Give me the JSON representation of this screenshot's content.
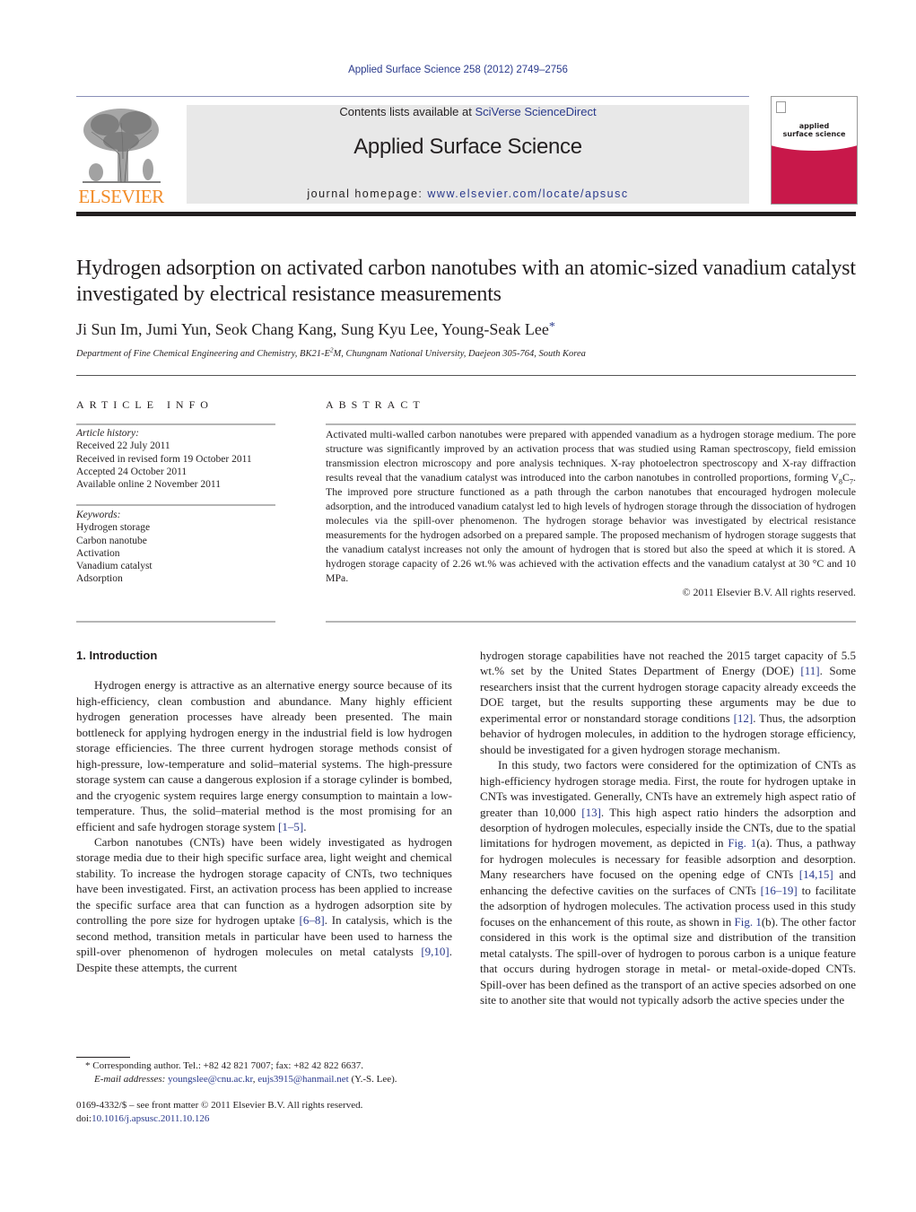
{
  "header": {
    "citation": "Applied Surface Science 258 (2012) 2749–2756",
    "publisher_logo_text": "ELSEVIER",
    "contents_prefix": "Contents lists available at ",
    "contents_link": "SciVerse ScienceDirect",
    "journal_name": "Applied Surface Science",
    "homepage_prefix": "journal homepage: ",
    "homepage_link": "www.elsevier.com/locate/apsusc",
    "cover_title_line1": "applied",
    "cover_title_line2": "surface science"
  },
  "article": {
    "title": "Hydrogen adsorption on activated carbon nanotubes with an atomic-sized vanadium catalyst investigated by electrical resistance measurements",
    "authors": "Ji Sun Im, Jumi Yun, Seok Chang Kang, Sung Kyu Lee, Young-Seak Lee",
    "corresponding_mark": "*",
    "affiliation_pre": "Department of Fine Chemical Engineering and Chemistry, BK21-E",
    "affiliation_sup": "2",
    "affiliation_post": "M, Chungnam National University, Daejeon 305-764, South Korea"
  },
  "article_info": {
    "heading": "ARTICLE INFO",
    "history_label": "Article history:",
    "history": [
      "Received 22 July 2011",
      "Received in revised form 19 October 2011",
      "Accepted 24 October 2011",
      "Available online 2 November 2011"
    ],
    "keywords_label": "Keywords:",
    "keywords": [
      "Hydrogen storage",
      "Carbon nanotube",
      "Activation",
      "Vanadium catalyst",
      "Adsorption"
    ]
  },
  "abstract": {
    "heading": "ABSTRACT",
    "text_1": "Activated multi-walled carbon nanotubes were prepared with appended vanadium as a hydrogen storage medium. The pore structure was significantly improved by an activation process that was studied using Raman spectroscopy, field emission transmission electron microscopy and pore analysis techniques. X-ray photoelectron spectroscopy and X-ray diffraction results reveal that the vanadium catalyst was introduced into the carbon nanotubes in controlled proportions, forming V",
    "sub_1": "8",
    "mid": "C",
    "sub_2": "7",
    "text_2": ". The improved pore structure functioned as a path through the carbon nanotubes that encouraged hydrogen molecule adsorption, and the introduced vanadium catalyst led to high levels of hydrogen storage through the dissociation of hydrogen molecules via the spill-over phenomenon. The hydrogen storage behavior was investigated by electrical resistance measurements for the hydrogen adsorbed on a prepared sample. The proposed mechanism of hydrogen storage suggests that the vanadium catalyst increases not only the amount of hydrogen that is stored but also the speed at which it is stored. A hydrogen storage capacity of 2.26 wt.% was achieved with the activation effects and the vanadium catalyst at 30 °C and 10 MPa.",
    "copyright": "© 2011 Elsevier B.V. All rights reserved."
  },
  "body": {
    "section_heading": "1.  Introduction",
    "left_p1_a": "Hydrogen energy is attractive as an alternative energy source because of its high-efficiency, clean combustion and abundance. Many highly efficient hydrogen generation processes have already been presented. The main bottleneck for applying hydrogen energy in the industrial field is low hydrogen storage efficiencies. The three current hydrogen storage methods consist of high-pressure, low-temperature and solid–material systems. The high-pressure storage system can cause a dangerous explosion if a storage cylinder is bombed, and the cryogenic system requires large energy consumption to maintain a low-temperature. Thus, the solid–material method is the most promising for an efficient and safe hydrogen storage system ",
    "ref_1_5": "[1–5]",
    "left_p2_a": "Carbon nanotubes (CNTs) have been widely investigated as hydrogen storage media due to their high specific surface area, light weight and chemical stability. To increase the hydrogen storage capacity of CNTs, two techniques have been investigated. First, an activation process has been applied to increase the specific surface area that can function as a hydrogen adsorption site by controlling the pore size for hydrogen uptake ",
    "ref_6_8": "[6–8]",
    "left_p2_b": ". In catalysis, which is the second method, transition metals in particular have been used to harness the spill-over phenomenon of hydrogen molecules on metal catalysts ",
    "ref_9_10": "[9,10]",
    "left_p2_c": ". Despite these attempts, the current",
    "right_p1_a": "hydrogen storage capabilities have not reached the 2015 target capacity of 5.5 wt.% set by the United States Department of Energy (DOE) ",
    "ref_11": "[11]",
    "right_p1_b": ". Some researchers insist that the current hydrogen storage capacity already exceeds the DOE target, but the results supporting these arguments may be due to experimental error or nonstandard storage conditions ",
    "ref_12": "[12]",
    "right_p1_c": ". Thus, the adsorption behavior of hydrogen molecules, in addition to the hydrogen storage efficiency, should be investigated for a given hydrogen storage mechanism.",
    "right_p2_a": "In this study, two factors were considered for the optimization of CNTs as high-efficiency hydrogen storage media. First, the route for hydrogen uptake in CNTs was investigated. Generally, CNTs have an extremely high aspect ratio of greater than 10,000 ",
    "ref_13": "[13]",
    "right_p2_b": ". This high aspect ratio hinders the adsorption and desorption of hydrogen molecules, especially inside the CNTs, due to the spatial limitations for hydrogen movement, as depicted in ",
    "fig_1a": "Fig. 1",
    "right_p2_c": "(a). Thus, a pathway for hydrogen molecules is necessary for feasible adsorption and desorption. Many researchers have focused on the opening edge of CNTs ",
    "ref_14_15": "[14,15]",
    "right_p2_d": " and enhancing the defective cavities on the surfaces of CNTs ",
    "ref_16_19": "[16–19]",
    "right_p2_e": " to facilitate the adsorption of hydrogen molecules. The activation process used in this study focuses on the enhancement of this route, as shown in ",
    "fig_1b": "Fig. 1",
    "right_p2_f": "(b). The other factor considered in this work is the optimal size and distribution of the transition metal catalysts. The spill-over of hydrogen to porous carbon is a unique feature that occurs during hydrogen storage in metal- or metal-oxide-doped CNTs. Spill-over has been defined as the transport of an active species adsorbed on one site to another site that would not typically adsorb the active species under the"
  },
  "footnote": {
    "mark": "*",
    "contact": "Corresponding author. Tel.: +82 42 821 7007; fax: +82 42 822 6637.",
    "email_label": "E-mail addresses:",
    "email_1": "youngslee@cnu.ac.kr",
    "email_2": "eujs3915@hanmail.net",
    "email_owner": "(Y.-S. Lee)."
  },
  "front_matter": {
    "issn_line": "0169-4332/$ – see front matter © 2011 Elsevier B.V. All rights reserved.",
    "doi_prefix": "doi:",
    "doi": "10.1016/j.apsusc.2011.10.126"
  },
  "colors": {
    "link": "#2a3a8c",
    "elsevier_orange": "#f28c28",
    "cover_red": "#c8184a",
    "masthead_grey": "#e8e8e8"
  }
}
